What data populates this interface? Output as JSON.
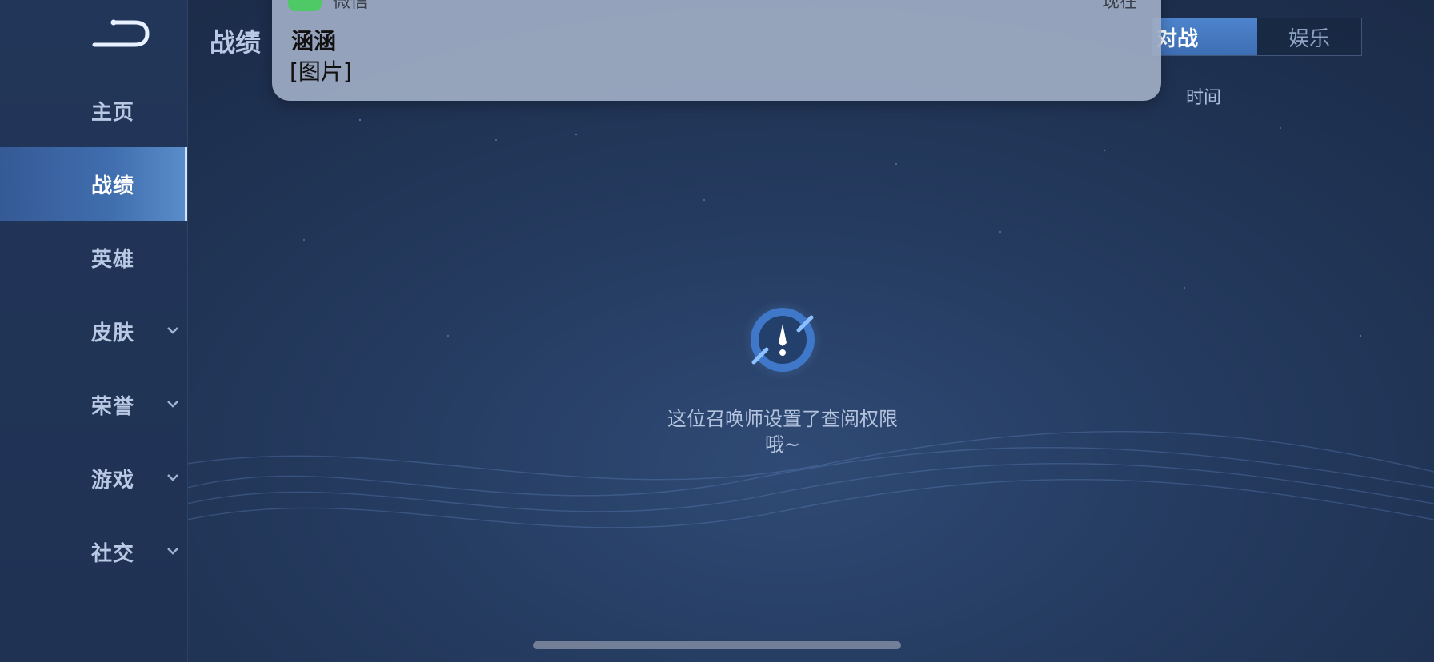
{
  "sidebar": {
    "items": [
      {
        "label": "主页",
        "active": false,
        "expandable": false
      },
      {
        "label": "战绩",
        "active": true,
        "expandable": false
      },
      {
        "label": "英雄",
        "active": false,
        "expandable": false
      },
      {
        "label": "皮肤",
        "active": false,
        "expandable": true
      },
      {
        "label": "荣誉",
        "active": false,
        "expandable": true
      },
      {
        "label": "游戏",
        "active": false,
        "expandable": true
      },
      {
        "label": "社交",
        "active": false,
        "expandable": true
      }
    ]
  },
  "header": {
    "title": "战绩",
    "tabs": [
      {
        "label": "对战",
        "active": true
      },
      {
        "label": "娱乐",
        "active": false
      }
    ],
    "sort_label": "时间"
  },
  "notification": {
    "app_name": "微信",
    "time": "现在",
    "sender": "涵涵",
    "message": "[图片]"
  },
  "empty_state": {
    "icon": "warning-badge-icon",
    "text_line1": "这位召唤师设置了查阅权限",
    "text_line2": "哦~"
  },
  "colors": {
    "background": "#243a5e",
    "sidebar": "#223659",
    "accent": "#4d84cc",
    "notification_bg": "#a0acc4",
    "wechat_green": "#4fc866"
  }
}
